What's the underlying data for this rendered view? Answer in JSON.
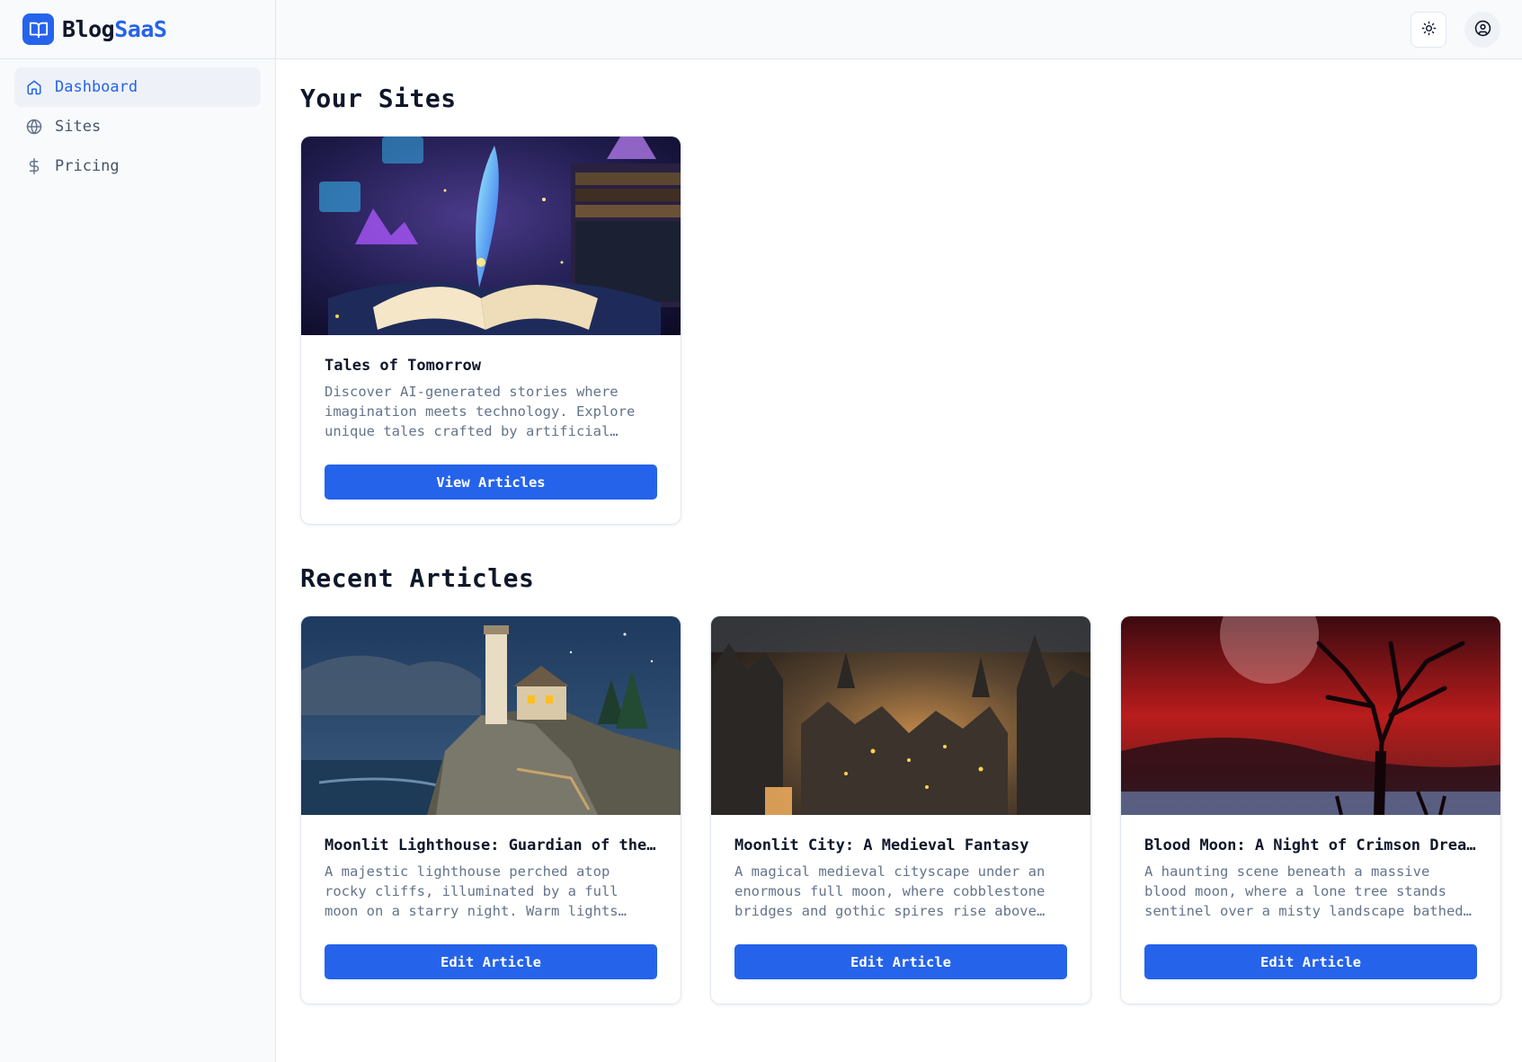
{
  "app": {
    "brand_prefix": "Blog",
    "brand_accent": "SaaS",
    "accent_color": "#2563eb"
  },
  "sidebar": {
    "items": [
      {
        "label": "Dashboard",
        "icon": "home-icon",
        "active": true
      },
      {
        "label": "Sites",
        "icon": "globe-icon",
        "active": false
      },
      {
        "label": "Pricing",
        "icon": "dollar-icon",
        "active": false
      }
    ]
  },
  "header": {
    "theme_toggle_icon": "sun-icon",
    "user_icon": "user-circle-icon"
  },
  "sites_section": {
    "title": "Your Sites",
    "cards": [
      {
        "title": "Tales of Tomorrow",
        "description": "Discover AI-generated stories where imagination meets technology. Explore unique tales crafted by artificial intelligence.",
        "button": "View Articles",
        "image": "open-book-with-glowing-quill"
      }
    ]
  },
  "articles_section": {
    "title": "Recent Articles",
    "cards": [
      {
        "title": "Moonlit Lighthouse: Guardian of the Night",
        "description": "A majestic lighthouse perched atop rocky cliffs, illuminated by a full moon on a starry night. Warm lights glow from the windows.",
        "button": "Edit Article",
        "image": "lighthouse-on-cliff-at-night"
      },
      {
        "title": "Moonlit City: A Medieval Fantasy",
        "description": "A magical medieval cityscape under an enormous full moon, where cobblestone bridges and gothic spires rise above the glowing streets.",
        "button": "Edit Article",
        "image": "medieval-fantasy-city"
      },
      {
        "title": "Blood Moon: A Night of Crimson Dreams",
        "description": "A haunting scene beneath a massive blood moon, where a lone tree stands sentinel over a misty landscape bathed in crimson light.",
        "button": "Edit Article",
        "image": "blood-moon-lone-tree"
      }
    ]
  }
}
